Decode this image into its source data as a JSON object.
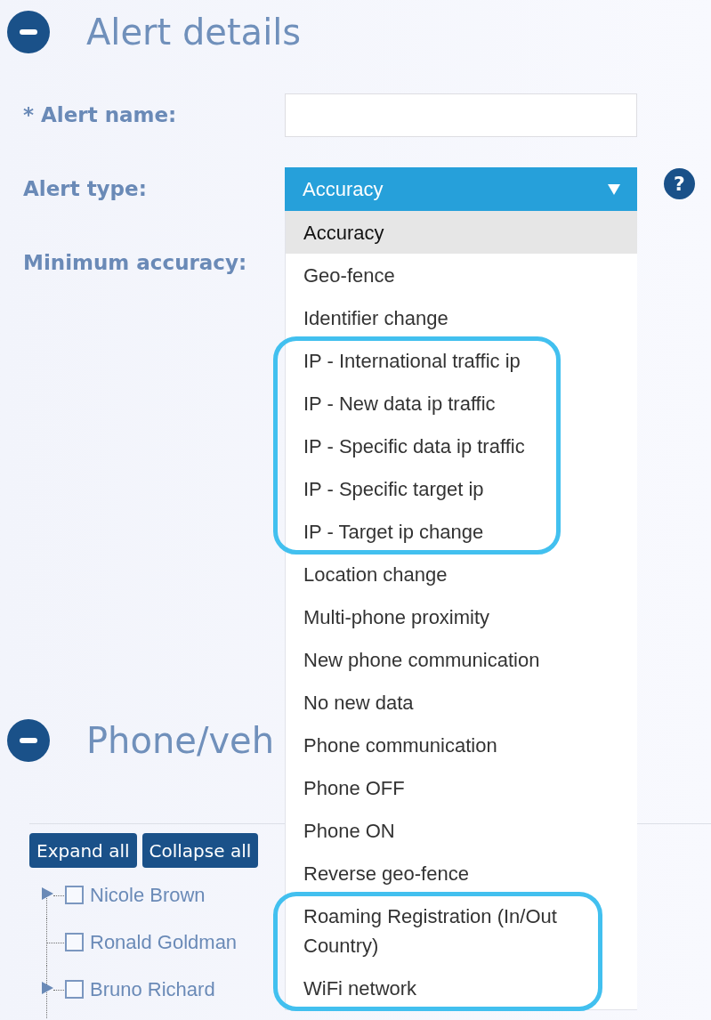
{
  "alert_details": {
    "title": "Alert details",
    "expanded": true,
    "fields": [
      {
        "kind": "text",
        "label": "* Alert name:"
      },
      {
        "kind": "select",
        "label": "Alert type:",
        "value": "Accuracy",
        "help": "?",
        "open": true,
        "options": [
          {
            "label": "Accuracy",
            "selected": true,
            "outlined": false
          },
          {
            "label": "Geo-fence",
            "selected": false,
            "outlined": false
          },
          {
            "label": "Identifier change",
            "selected": false,
            "outlined": false
          },
          {
            "label": "IP - International traffic ip",
            "selected": false,
            "outlined": true
          },
          {
            "label": "IP - New data ip traffic",
            "selected": false,
            "outlined": true
          },
          {
            "label": "IP - Specific data ip traffic",
            "selected": false,
            "outlined": true
          },
          {
            "label": "IP - Specific target ip",
            "selected": false,
            "outlined": true
          },
          {
            "label": "IP - Target ip change",
            "selected": false,
            "outlined": true
          },
          {
            "label": "Location change",
            "selected": false,
            "outlined": false
          },
          {
            "label": "Multi-phone proximity",
            "selected": false,
            "outlined": false
          },
          {
            "label": "New phone communication",
            "selected": false,
            "outlined": false
          },
          {
            "label": "No new data",
            "selected": false,
            "outlined": false
          },
          {
            "label": "Phone communication",
            "selected": false,
            "outlined": false
          },
          {
            "label": "Phone OFF",
            "selected": false,
            "outlined": false
          },
          {
            "label": "Phone ON",
            "selected": false,
            "outlined": false
          },
          {
            "label": "Reverse geo-fence",
            "selected": false,
            "outlined": false
          },
          {
            "label": "Roaming Registration (In/Out Country)",
            "selected": false,
            "outlined": true
          },
          {
            "label": "WiFi network",
            "selected": false,
            "outlined": true
          }
        ]
      },
      {
        "kind": "label",
        "label": "Minimum accuracy:"
      }
    ]
  },
  "phone_vehicle": {
    "title": "Phone/veh",
    "expanded": true,
    "buttons": [
      "Expand all",
      "Collapse all"
    ],
    "tree": [
      {
        "kind": "branch",
        "label": "Nicole Brown",
        "checked": false,
        "expanded": false
      },
      {
        "kind": "leaf",
        "label": "Ronald Goldman",
        "checked": false
      },
      {
        "kind": "branch",
        "label": "Bruno Richard",
        "checked": false,
        "expanded": false
      }
    ]
  }
}
